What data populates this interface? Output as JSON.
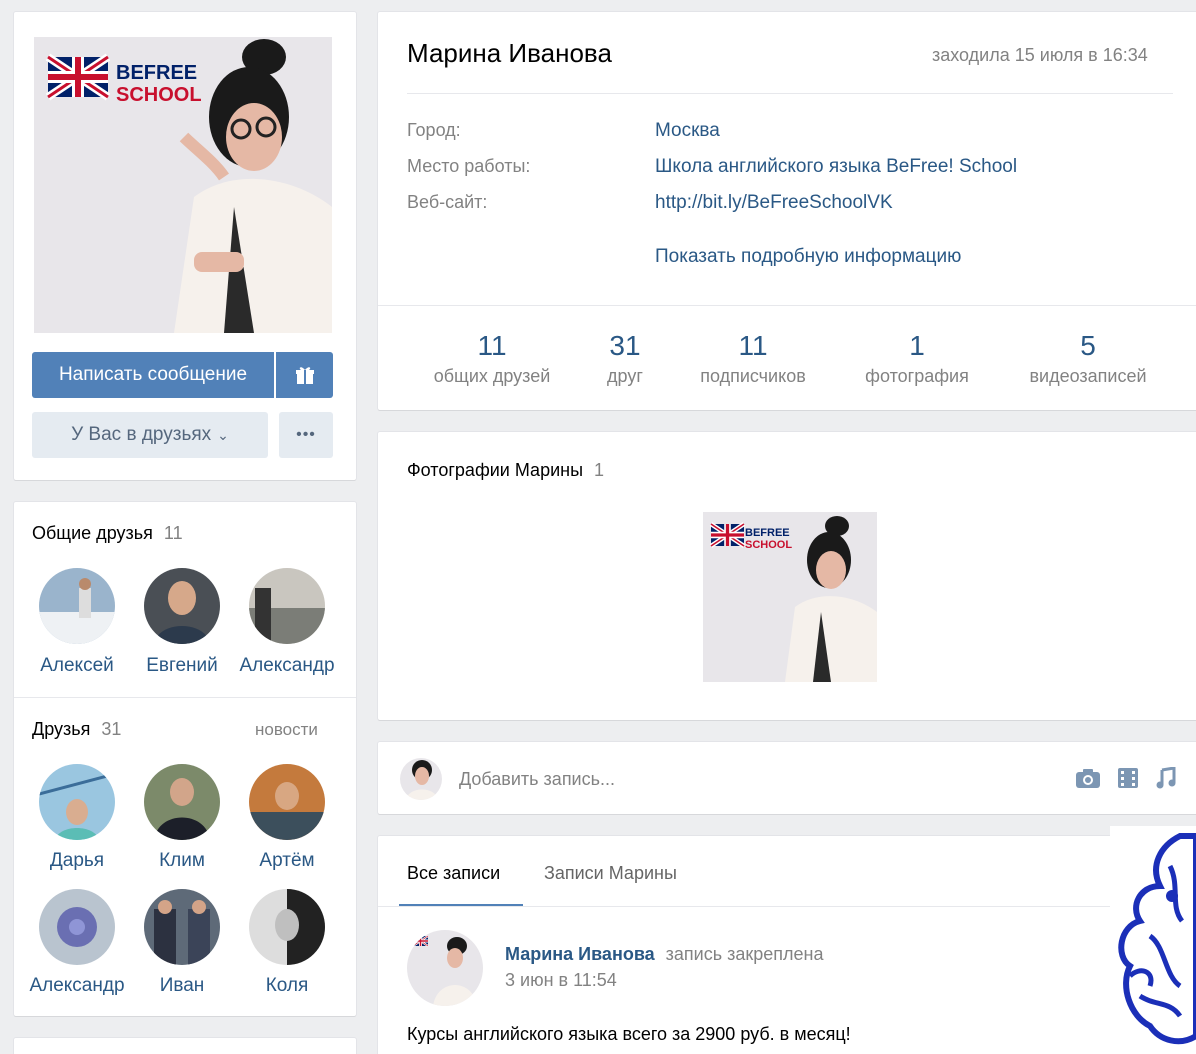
{
  "profile": {
    "name": "Марина Иванова",
    "last_seen": "заходила 15 июля в 16:34",
    "info": [
      {
        "label": "Город:",
        "value": "Москва"
      },
      {
        "label": "Место работы:",
        "value": "Школа английского языка BeFree! School"
      },
      {
        "label": "Веб-сайт:",
        "value": "http://bit.ly/BeFreeSchoolVK"
      }
    ],
    "show_more": "Показать подробную информацию",
    "counters": [
      {
        "num": "11",
        "label": "общих друзей"
      },
      {
        "num": "31",
        "label": "друг"
      },
      {
        "num": "11",
        "label": "подписчиков"
      },
      {
        "num": "1",
        "label": "фотография"
      },
      {
        "num": "5",
        "label": "видеозаписей"
      }
    ]
  },
  "logo": {
    "line1": "BEFREE",
    "line2": "SCHOOL"
  },
  "actions": {
    "message": "Написать сообщение",
    "friend_status": "У Вас в друзьях",
    "more": "•••"
  },
  "mutual_friends": {
    "title": "Общие друзья",
    "count": "11",
    "people": [
      "Алексей",
      "Евгений",
      "Александр"
    ]
  },
  "friends": {
    "title": "Друзья",
    "count": "31",
    "news_link": "новости",
    "people": [
      "Дарья",
      "Клим",
      "Артём",
      "Александр",
      "Иван",
      "Коля"
    ]
  },
  "photos": {
    "title": "Фотографии Марины",
    "count": "1"
  },
  "composer": {
    "placeholder": "Добавить запись..."
  },
  "wall": {
    "tabs": [
      "Все записи",
      "Записи Марины"
    ],
    "post": {
      "author": "Марина Иванова",
      "pinned": "запись закреплена",
      "date": "3 июн в 11:54",
      "text": "Курсы английского языка всего за 2900 руб. в месяц!"
    }
  },
  "colors": {
    "accent": "#5181b8",
    "link": "#2a5885",
    "background": "#edeef0",
    "logo_red": "#c8102e",
    "logo_blue": "#012169"
  }
}
